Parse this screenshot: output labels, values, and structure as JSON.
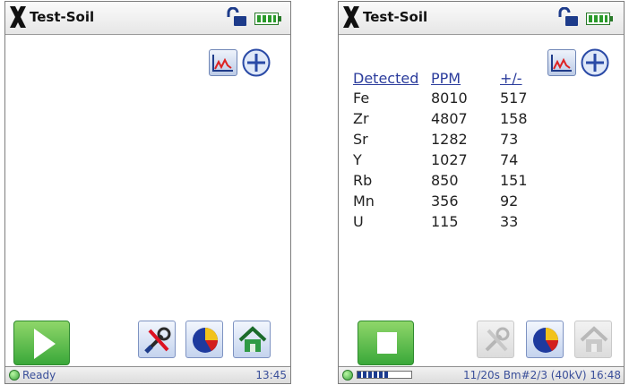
{
  "left": {
    "title": "Test-Soil",
    "status_text": "Ready",
    "time": "13:45"
  },
  "right": {
    "title": "Test-Soil",
    "table": {
      "headers": [
        "Detected",
        "PPM",
        "+/-"
      ],
      "rows": [
        [
          "Fe",
          "8010",
          "517"
        ],
        [
          "Zr",
          "4807",
          "158"
        ],
        [
          "Sr",
          "1282",
          "73"
        ],
        [
          "Y",
          "1027",
          "74"
        ],
        [
          "Rb",
          "850",
          "151"
        ],
        [
          "Mn",
          "356",
          "92"
        ],
        [
          "U",
          "115",
          "33"
        ]
      ]
    },
    "status_text": "11/20s Bm#2/3 (40kV) 16:48",
    "progress": 0.6
  },
  "icons": {
    "logo": "x-logo-icon",
    "lock": "unlocked-padlock-icon",
    "battery": "battery-full-icon",
    "graph": "spectrum-graph-icon",
    "add": "plus-circle-icon",
    "start": "play-icon",
    "stop": "stop-icon",
    "tools": "tools-icon",
    "results": "pie-chart-icon",
    "home": "home-icon"
  },
  "colors": {
    "accent": "#2b3c9c",
    "start_green": "#3aa83a",
    "status_green": "#39a23a"
  }
}
